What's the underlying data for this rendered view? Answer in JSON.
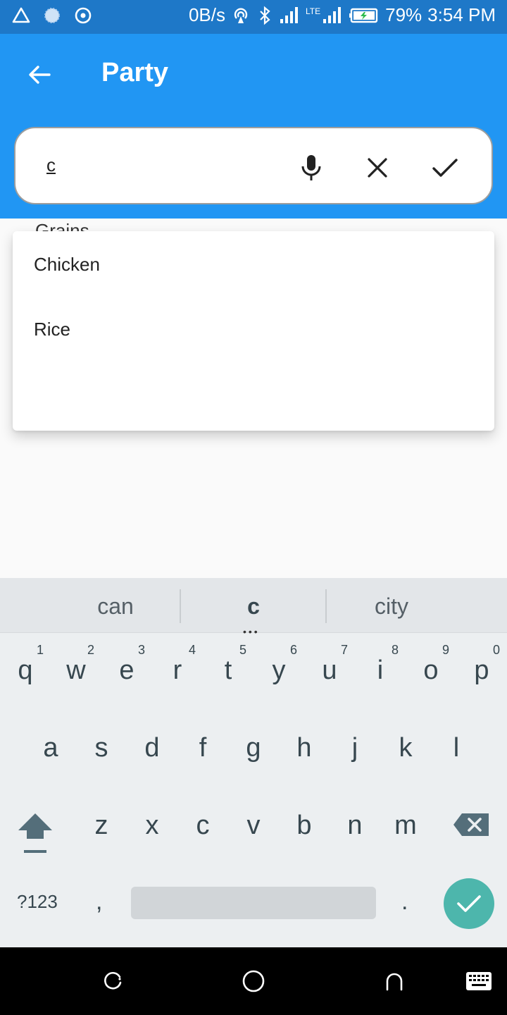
{
  "status_bar": {
    "speed": "0B/s",
    "lte": "LTE",
    "battery": "79%",
    "time": "3:54 PM"
  },
  "app_bar": {
    "title": "Party"
  },
  "search": {
    "value": "c"
  },
  "behind_label": "Grains",
  "dropdown": {
    "items": [
      "Chicken",
      "Rice"
    ]
  },
  "keyboard": {
    "suggestions": [
      "can",
      "c",
      "city"
    ],
    "row1": [
      {
        "ch": "q",
        "num": "1"
      },
      {
        "ch": "w",
        "num": "2"
      },
      {
        "ch": "e",
        "num": "3"
      },
      {
        "ch": "r",
        "num": "4"
      },
      {
        "ch": "t",
        "num": "5"
      },
      {
        "ch": "y",
        "num": "6"
      },
      {
        "ch": "u",
        "num": "7"
      },
      {
        "ch": "i",
        "num": "8"
      },
      {
        "ch": "o",
        "num": "9"
      },
      {
        "ch": "p",
        "num": "0"
      }
    ],
    "row2": [
      "a",
      "s",
      "d",
      "f",
      "g",
      "h",
      "j",
      "k",
      "l"
    ],
    "row3": [
      "z",
      "x",
      "c",
      "v",
      "b",
      "n",
      "m"
    ],
    "symbols_label": "?123",
    "comma": ",",
    "period": "."
  }
}
